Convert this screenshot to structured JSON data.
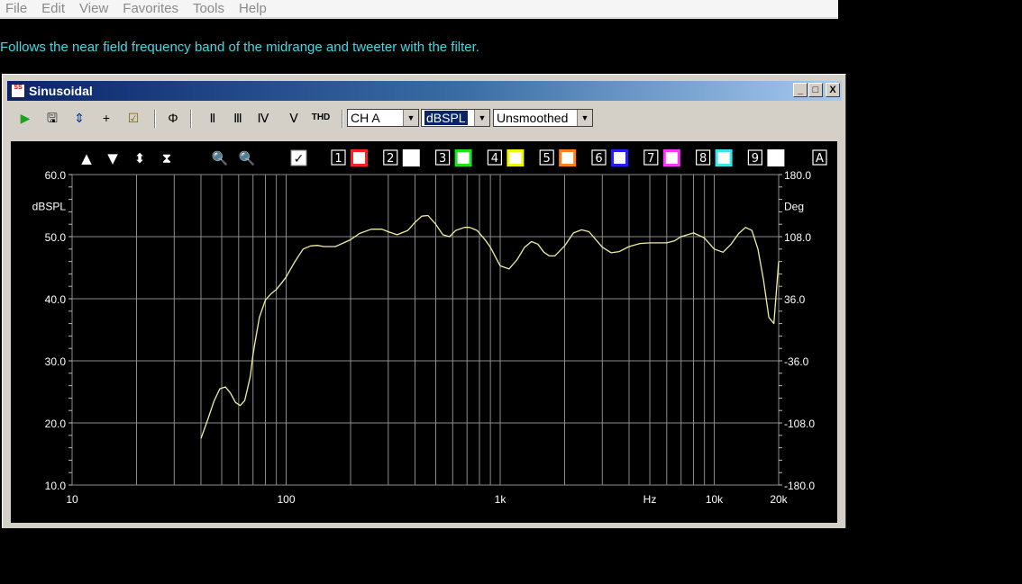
{
  "menu": [
    "File",
    "Edit",
    "View",
    "Favorites",
    "Tools",
    "Help"
  ],
  "caption": "Follows the near field frequency band of the midrange and tweeter with the filter.",
  "window": {
    "title": "Sinusoidal",
    "icon_text": "SS",
    "minimize": "_",
    "maximize": "□",
    "close": "X"
  },
  "toolbar": {
    "buttons": [
      {
        "name": "play-icon",
        "glyph": "▶",
        "color": "#1aa31a"
      },
      {
        "name": "save-icon",
        "glyph": "🖫",
        "color": "#000"
      },
      {
        "name": "marker-icon",
        "glyph": "⇕",
        "color": "#003399"
      },
      {
        "name": "cursor-icon",
        "glyph": "+",
        "color": "#000"
      },
      {
        "name": "check-icon",
        "glyph": "☑",
        "color": "#806600"
      },
      {
        "name": "phase-icon",
        "glyph": "Φ",
        "color": "#000"
      },
      {
        "name": "roman-2-icon",
        "glyph": "Ⅱ",
        "color": "#000"
      },
      {
        "name": "roman-3-icon",
        "glyph": "Ⅲ",
        "color": "#000"
      },
      {
        "name": "roman-4-icon",
        "glyph": "Ⅳ",
        "color": "#000"
      },
      {
        "name": "roman-5-icon",
        "glyph": "Ⅴ",
        "color": "#000"
      },
      {
        "name": "thd-button",
        "glyph": "THD",
        "color": "#000"
      }
    ],
    "channel": "CH A",
    "unit": "dBSPL",
    "smoothing": "Unsmoothed"
  },
  "plot_controls": {
    "arrows": [
      "▲",
      "▼",
      "⬍",
      "⧗"
    ],
    "zoom": [
      "🔍",
      "🔍"
    ],
    "check": "✓",
    "traces": [
      {
        "label": "1",
        "color": "#ff2020"
      },
      {
        "label": "2",
        "color": "#ffffff"
      },
      {
        "label": "3",
        "color": "#19e619"
      },
      {
        "label": "4",
        "color": "#f5f50a"
      },
      {
        "label": "5",
        "color": "#ff7f1a"
      },
      {
        "label": "6",
        "color": "#2020ff"
      },
      {
        "label": "7",
        "color": "#ff33ff"
      },
      {
        "label": "8",
        "color": "#39e6f0"
      },
      {
        "label": "9",
        "color": "#ffffff"
      }
    ],
    "auto": "A"
  },
  "chart_data": {
    "type": "line",
    "ylabel": "dBSPL",
    "y2label": "Deg",
    "xlabel": "Hz",
    "xscale": "log",
    "xlim": [
      10,
      20000
    ],
    "ylim": [
      10,
      60
    ],
    "y2lim": [
      -180,
      180
    ],
    "yticks": [
      "60.0",
      "50.0",
      "40.0",
      "30.0",
      "20.0",
      "10.0"
    ],
    "y2ticks": [
      "180.0",
      "108.0",
      "36.0",
      "-36.0",
      "-108.0",
      "-180.0"
    ],
    "xticks": [
      {
        "v": 10,
        "label": "10"
      },
      {
        "v": 100,
        "label": "100"
      },
      {
        "v": 1000,
        "label": "1k"
      },
      {
        "v": 10000,
        "label": "10k"
      },
      {
        "v": 20000,
        "label": "20k"
      }
    ],
    "unit_label_position": 5000,
    "grid": true,
    "line_color": "#f0efa0",
    "series": [
      {
        "x": [
          40,
          43,
          46,
          49,
          52,
          55,
          58,
          61,
          64,
          66,
          68,
          70,
          72,
          75,
          80,
          85,
          90,
          95,
          100,
          110,
          120,
          130,
          140,
          150,
          170,
          200,
          220,
          250,
          280,
          300,
          330,
          370,
          400,
          430,
          460,
          500,
          540,
          580,
          620,
          680,
          720,
          780,
          850,
          900,
          1000,
          1100,
          1200,
          1300,
          1400,
          1500,
          1600,
          1700,
          1800,
          2000,
          2200,
          2400,
          2600,
          3000,
          3300,
          3600,
          4000,
          4500,
          5000,
          5500,
          6000,
          6500,
          7000,
          8000,
          9000,
          10000,
          11000,
          12000,
          13000,
          14000,
          15000,
          16000,
          17000,
          18000,
          19000,
          20000
        ],
        "y": [
          17.5,
          20.5,
          23.5,
          25.5,
          25.8,
          24.8,
          23.3,
          22.8,
          23.6,
          25.5,
          27.5,
          31,
          33.5,
          37,
          39.8,
          40.8,
          41.5,
          42.5,
          43.5,
          46,
          48,
          48.5,
          48.6,
          48.4,
          48.4,
          49.5,
          50.5,
          51.2,
          51.2,
          50.8,
          50.3,
          51,
          52.3,
          53.3,
          53.4,
          52,
          50.3,
          50,
          51,
          51.5,
          51.5,
          51,
          49.5,
          48.3,
          45.3,
          44.8,
          46.3,
          48.3,
          49.2,
          48.8,
          47.5,
          46.9,
          46.9,
          48.5,
          50.6,
          51.1,
          50.8,
          48.3,
          47.4,
          47.6,
          48.4,
          48.9,
          49,
          49,
          49,
          49.3,
          50,
          50.6,
          49.8,
          48,
          47.5,
          48.8,
          50.5,
          51.5,
          51,
          48,
          43,
          37,
          36,
          46
        ]
      }
    ]
  }
}
